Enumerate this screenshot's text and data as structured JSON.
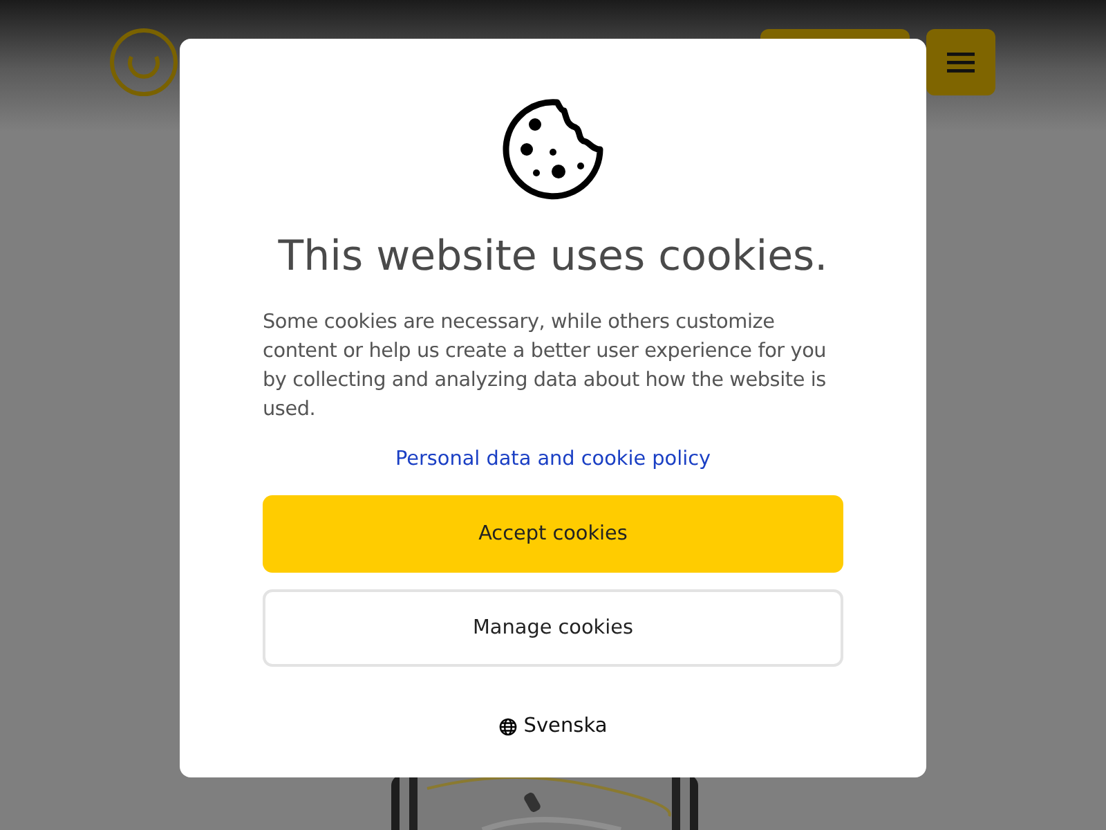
{
  "dialog": {
    "title": "This website uses cookies.",
    "body": "Some cookies are necessary, while others customize content or help us create a better user experience for you by collecting and analyzing data about how the website is used.",
    "policy_link": "Personal data and cookie policy",
    "buttons": [
      {
        "label": "Accept cookies",
        "kind": "primary"
      },
      {
        "label": "Manage cookies",
        "kind": "secondary"
      }
    ],
    "language": "Svenska"
  }
}
